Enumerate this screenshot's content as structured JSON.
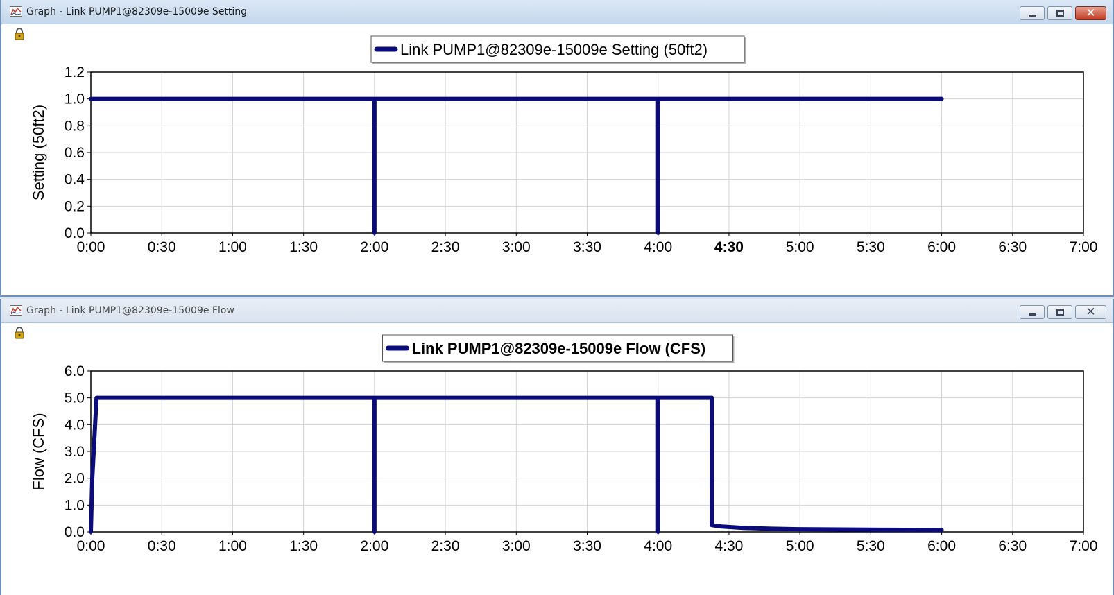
{
  "windows": [
    {
      "id": "setting",
      "title": "Graph - Link PUMP1@82309e-15009e Setting",
      "active": true,
      "icons": {
        "app": "graph-app-icon",
        "lock": "lock-icon",
        "minimize": "minimize-icon",
        "maximize": "maximize-icon",
        "close": "close-icon"
      },
      "close_glyph": "✕"
    },
    {
      "id": "flow",
      "title": "Graph - Link PUMP1@82309e-15009e Flow",
      "active": false,
      "icons": {
        "app": "graph-app-icon",
        "lock": "lock-icon",
        "minimize": "minimize-icon",
        "maximize": "maximize-icon",
        "close": "close-icon"
      },
      "close_glyph": "✕"
    }
  ],
  "chart_data": [
    {
      "type": "line",
      "title": "",
      "legend": "Link PUMP1@82309e-15009e Setting (50ft2)",
      "legend_bold": false,
      "legend_position": "top-center",
      "xlabel": "",
      "ylabel": "Setting (50ft2)",
      "x_unit": "hours",
      "xlim": [
        0,
        7
      ],
      "ylim": [
        0,
        1.2
      ],
      "grid": true,
      "color": "#0b0c7a",
      "xticks": [
        {
          "v": 0,
          "label": "0:00"
        },
        {
          "v": 0.5,
          "label": "0:30"
        },
        {
          "v": 1,
          "label": "1:00"
        },
        {
          "v": 1.5,
          "label": "1:30"
        },
        {
          "v": 2,
          "label": "2:00"
        },
        {
          "v": 2.5,
          "label": "2:30"
        },
        {
          "v": 3,
          "label": "3:00"
        },
        {
          "v": 3.5,
          "label": "3:30"
        },
        {
          "v": 4,
          "label": "4:00"
        },
        {
          "v": 4.5,
          "label": "4:30",
          "bold": true
        },
        {
          "v": 5,
          "label": "5:00"
        },
        {
          "v": 5.5,
          "label": "5:30"
        },
        {
          "v": 6,
          "label": "6:00"
        },
        {
          "v": 6.5,
          "label": "6:30"
        },
        {
          "v": 7,
          "label": "7:00"
        }
      ],
      "yticks": [
        {
          "v": 0,
          "label": "0.0"
        },
        {
          "v": 0.2,
          "label": "0.2"
        },
        {
          "v": 0.4,
          "label": "0.4"
        },
        {
          "v": 0.6,
          "label": "0.6"
        },
        {
          "v": 0.8,
          "label": "0.8"
        },
        {
          "v": 1.0,
          "label": "1.0"
        },
        {
          "v": 1.2,
          "label": "1.2"
        }
      ],
      "series": [
        {
          "x": [
            0,
            2,
            2,
            2,
            4,
            4,
            4,
            6
          ],
          "y": [
            1.0,
            1.0,
            0.0,
            1.0,
            1.0,
            0.0,
            1.0,
            1.0
          ]
        }
      ]
    },
    {
      "type": "line",
      "title": "",
      "legend": "Link PUMP1@82309e-15009e Flow (CFS)",
      "legend_bold": true,
      "legend_position": "top-center",
      "xlabel": "",
      "ylabel": "Flow (CFS)",
      "x_unit": "hours",
      "xlim": [
        0,
        7
      ],
      "ylim": [
        0,
        6
      ],
      "grid": true,
      "color": "#0b0c7a",
      "xticks": [
        {
          "v": 0,
          "label": "0:00"
        },
        {
          "v": 0.5,
          "label": "0:30"
        },
        {
          "v": 1,
          "label": "1:00"
        },
        {
          "v": 1.5,
          "label": "1:30"
        },
        {
          "v": 2,
          "label": "2:00"
        },
        {
          "v": 2.5,
          "label": "2:30"
        },
        {
          "v": 3,
          "label": "3:00"
        },
        {
          "v": 3.5,
          "label": "3:30"
        },
        {
          "v": 4,
          "label": "4:00"
        },
        {
          "v": 4.5,
          "label": "4:30"
        },
        {
          "v": 5,
          "label": "5:00"
        },
        {
          "v": 5.5,
          "label": "5:30"
        },
        {
          "v": 6,
          "label": "6:00"
        },
        {
          "v": 6.5,
          "label": "6:30"
        },
        {
          "v": 7,
          "label": "7:00"
        }
      ],
      "yticks": [
        {
          "v": 0,
          "label": "0.0"
        },
        {
          "v": 1,
          "label": "1.0"
        },
        {
          "v": 2,
          "label": "2.0"
        },
        {
          "v": 3,
          "label": "3.0"
        },
        {
          "v": 4,
          "label": "4.0"
        },
        {
          "v": 5,
          "label": "5.0"
        },
        {
          "v": 6,
          "label": "6.0"
        }
      ],
      "series": [
        {
          "x": [
            0,
            0.01,
            0.04,
            2,
            2,
            2,
            4,
            4,
            4,
            4.38,
            4.38,
            4.45,
            4.6,
            4.8,
            5.0,
            5.3,
            5.6,
            6.0
          ],
          "y": [
            0,
            2.0,
            5.0,
            5.0,
            0.0,
            5.0,
            5.0,
            0.0,
            5.0,
            5.0,
            0.25,
            0.2,
            0.15,
            0.12,
            0.1,
            0.09,
            0.08,
            0.07
          ]
        }
      ]
    }
  ]
}
